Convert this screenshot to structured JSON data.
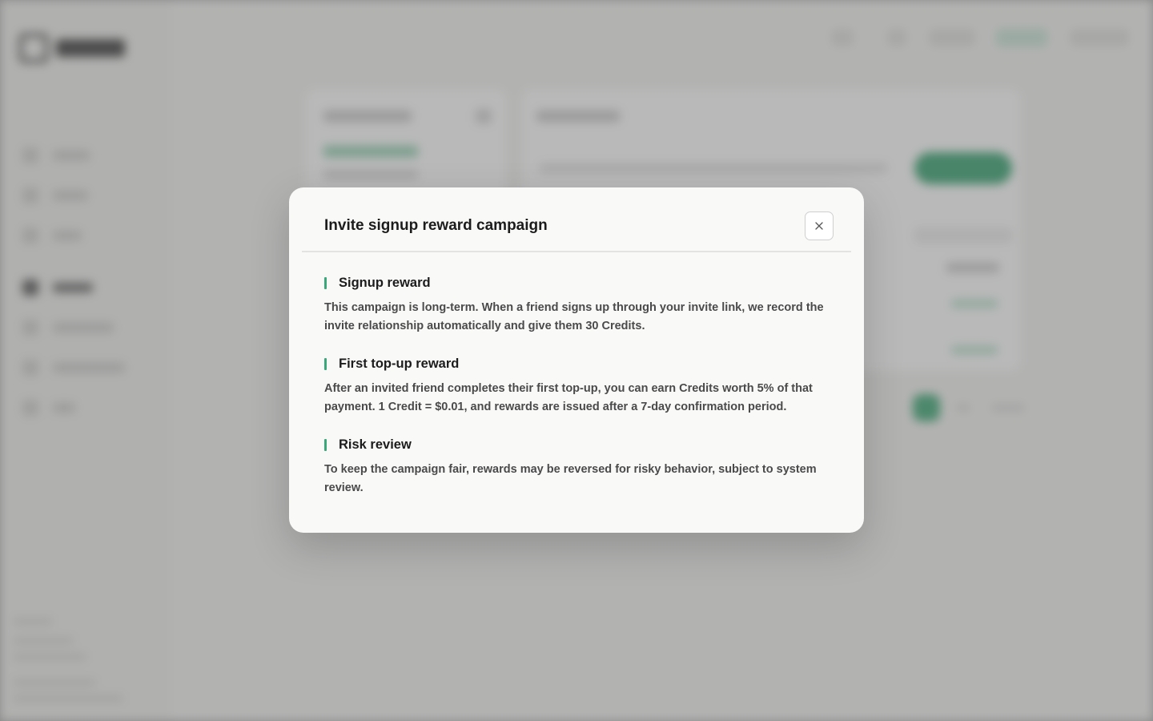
{
  "modal": {
    "title": "Invite signup reward campaign",
    "close_icon": "close-icon",
    "sections": [
      {
        "title": "Signup reward",
        "body": "This campaign is long-term. When a friend signs up through your invite link, we record the invite relationship automatically and give them 30 Credits."
      },
      {
        "title": "First top-up reward",
        "body": "After an invited friend completes their first top-up, you can earn Credits worth 5% of that payment. 1 Credit = $0.01, and rewards are issued after a 7-day confirmation period."
      },
      {
        "title": "Risk review",
        "body": "To keep the campaign fair, rewards may be reversed for risky behavior, subject to system review."
      }
    ]
  },
  "colors": {
    "accent": "#3aa77a",
    "modal_background": "#f9f9f8",
    "overlay": "rgba(60,60,60,0.36)",
    "title_text": "#1c1c1c",
    "body_text": "#4a4a4a"
  }
}
